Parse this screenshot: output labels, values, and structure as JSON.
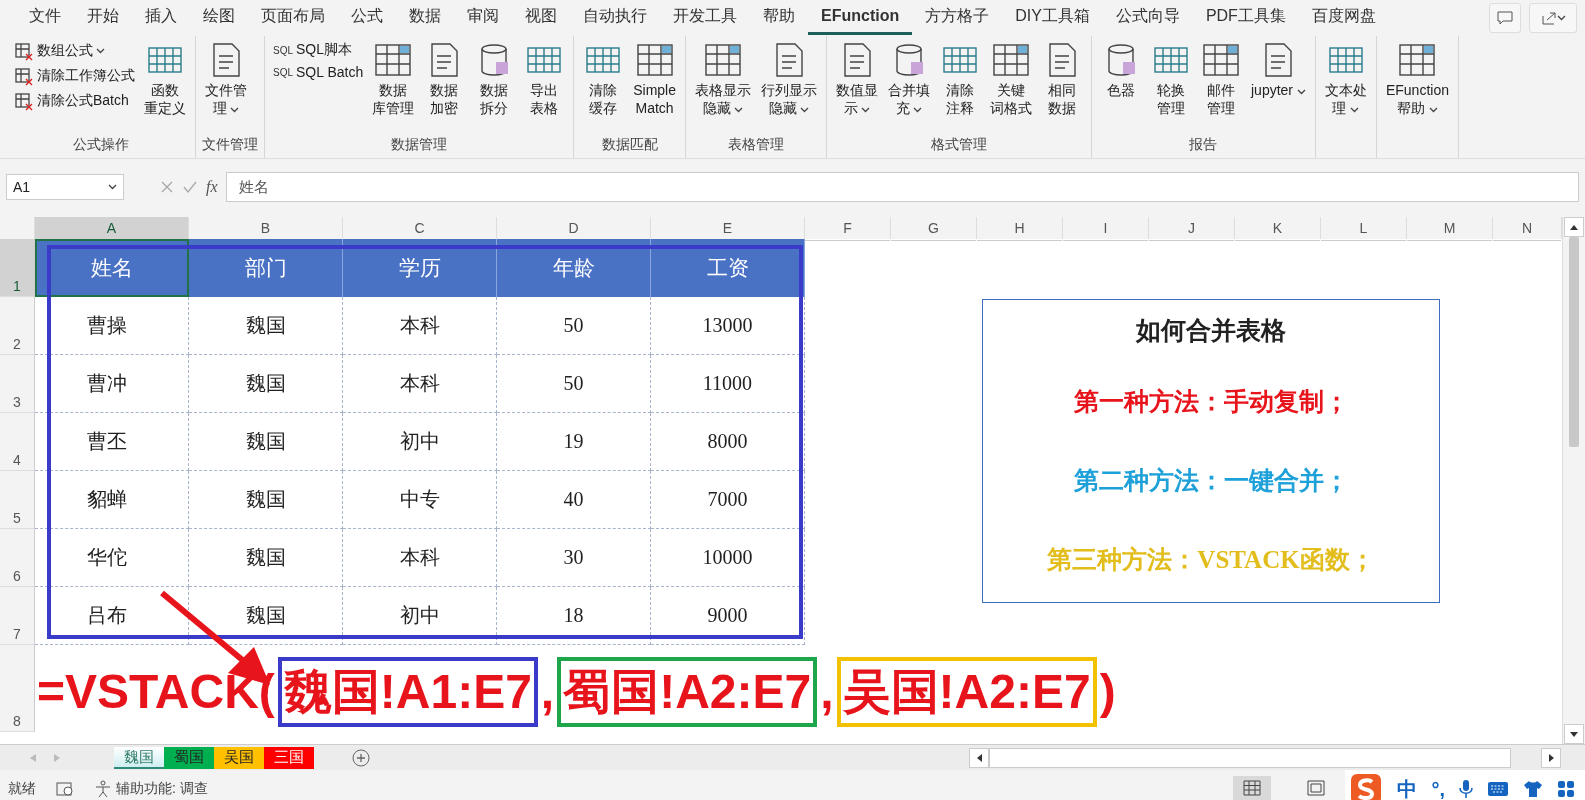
{
  "menu_tabs": [
    {
      "label": "文件",
      "selected": false
    },
    {
      "label": "开始",
      "selected": false
    },
    {
      "label": "插入",
      "selected": false
    },
    {
      "label": "绘图",
      "selected": false
    },
    {
      "label": "页面布局",
      "selected": false
    },
    {
      "label": "公式",
      "selected": false
    },
    {
      "label": "数据",
      "selected": false
    },
    {
      "label": "审阅",
      "selected": false
    },
    {
      "label": "视图",
      "selected": false
    },
    {
      "label": "自动执行",
      "selected": false
    },
    {
      "label": "开发工具",
      "selected": false
    },
    {
      "label": "帮助",
      "selected": false
    },
    {
      "label": "EFunction",
      "selected": true
    },
    {
      "label": "方方格子",
      "selected": false
    },
    {
      "label": "DIY工具箱",
      "selected": false
    },
    {
      "label": "公式向导",
      "selected": false
    },
    {
      "label": "PDF工具集",
      "selected": false
    },
    {
      "label": "百度网盘",
      "selected": false
    }
  ],
  "ribbon_groups": [
    {
      "label": "公式操作",
      "items": [
        {
          "kind": "small",
          "lines": [
            "数组公式"
          ],
          "dropdown": true
        },
        {
          "kind": "small",
          "lines": [
            "清除工作簿公式"
          ],
          "dropdown": false
        },
        {
          "kind": "small",
          "lines": [
            "清除公式Batch"
          ],
          "dropdown": false
        },
        {
          "kind": "large",
          "lines": [
            "函数",
            "重定义"
          ],
          "dropdown": false
        }
      ]
    },
    {
      "label": "文件管理",
      "items": [
        {
          "kind": "large",
          "lines": [
            "文件管",
            "理"
          ],
          "dropdown": true
        }
      ]
    },
    {
      "label": "数据管理",
      "items": [
        {
          "kind": "small",
          "prefix": "SQL",
          "lines": [
            "SQL脚本"
          ],
          "dropdown": false
        },
        {
          "kind": "small",
          "prefix": "SQL",
          "lines": [
            "SQL Batch"
          ],
          "dropdown": false
        },
        {
          "kind": "large",
          "lines": [
            "数据",
            "库管理"
          ],
          "dropdown": false
        },
        {
          "kind": "large",
          "lines": [
            "数据",
            "加密"
          ],
          "dropdown": false
        },
        {
          "kind": "large",
          "lines": [
            "数据",
            "拆分"
          ],
          "dropdown": false
        },
        {
          "kind": "large",
          "lines": [
            "导出",
            "表格"
          ],
          "dropdown": false
        }
      ]
    },
    {
      "label": "数据匹配",
      "items": [
        {
          "kind": "large",
          "lines": [
            "清除",
            "缓存"
          ],
          "dropdown": false
        },
        {
          "kind": "large",
          "lines": [
            "Simple",
            "Match"
          ],
          "dropdown": false
        }
      ]
    },
    {
      "label": "表格管理",
      "items": [
        {
          "kind": "large",
          "lines": [
            "表格显示",
            "隐藏"
          ],
          "dropdown": true
        },
        {
          "kind": "large",
          "lines": [
            "行列显示",
            "隐藏"
          ],
          "dropdown": true
        }
      ]
    },
    {
      "label": "格式管理",
      "items": [
        {
          "kind": "large",
          "lines": [
            "数值显",
            "示"
          ],
          "dropdown": true
        },
        {
          "kind": "large",
          "lines": [
            "合并填",
            "充"
          ],
          "dropdown": true
        },
        {
          "kind": "large",
          "lines": [
            "清除",
            "注释"
          ],
          "dropdown": false
        },
        {
          "kind": "large",
          "lines": [
            "关键",
            "词格式"
          ],
          "dropdown": false
        },
        {
          "kind": "large",
          "lines": [
            "相同",
            "数据"
          ],
          "dropdown": false
        }
      ]
    },
    {
      "label": "报告",
      "items": [
        {
          "kind": "large",
          "lines": [
            "色器"
          ],
          "dropdown": false
        },
        {
          "kind": "large",
          "lines": [
            "轮换",
            "管理"
          ],
          "dropdown": false
        },
        {
          "kind": "large",
          "lines": [
            "邮件",
            "管理"
          ],
          "dropdown": false
        },
        {
          "kind": "large",
          "lines": [
            "jupyter"
          ],
          "dropdown": true
        }
      ]
    },
    {
      "items": [
        {
          "kind": "large",
          "lines": [
            "文本处",
            "理"
          ],
          "dropdown": true
        }
      ]
    },
    {
      "items": [
        {
          "kind": "large",
          "lines": [
            "EFunction",
            "帮助"
          ],
          "dropdown": true
        }
      ]
    }
  ],
  "formula_bar": {
    "name_box": "A1",
    "fx": "fx",
    "value": "姓名"
  },
  "columns": [
    "A",
    "B",
    "C",
    "D",
    "E",
    "F",
    "G",
    "H",
    "I",
    "J",
    "K",
    "L",
    "M",
    "N"
  ],
  "rows": [
    "1",
    "2",
    "3",
    "4",
    "5",
    "6",
    "7",
    "8"
  ],
  "table": {
    "header": [
      "姓名",
      "部门",
      "学历",
      "年龄",
      "工资"
    ],
    "rows": [
      [
        "曹操",
        "魏国",
        "本科",
        "50",
        "13000"
      ],
      [
        "曹冲",
        "魏国",
        "本科",
        "50",
        "11000"
      ],
      [
        "曹丕",
        "魏国",
        "初中",
        "19",
        "8000"
      ],
      [
        "貂蝉",
        "魏国",
        "中专",
        "40",
        "7000"
      ],
      [
        "华佗",
        "魏国",
        "本科",
        "30",
        "10000"
      ],
      [
        "吕布",
        "魏国",
        "初中",
        "18",
        "9000"
      ]
    ]
  },
  "note_box": {
    "title": "如何合并表格",
    "lines": [
      {
        "text": "第一种方法：手动复制；",
        "color": "#e8141c"
      },
      {
        "text": "第二种方法：一键合并；",
        "color": "#1ea0d8"
      },
      {
        "text": "第三种方法：VSTACK函数；",
        "color": "#e2bd1c"
      }
    ]
  },
  "formula_overlay": [
    {
      "text": "=VSTACK("
    },
    {
      "text": "魏国!A1:E7",
      "color": "#3b3bc9"
    },
    {
      "text": ","
    },
    {
      "text": "蜀国!A2:E7",
      "color": "#1ea64a"
    },
    {
      "text": ","
    },
    {
      "text": "吴国!A2:E7",
      "color": "#f2c200"
    },
    {
      "text": ")"
    }
  ],
  "sheet_tabs": [
    {
      "label": "魏国",
      "selected": true,
      "color": "#2e8b7a"
    },
    {
      "label": "蜀国",
      "selected": false,
      "color": "#00b050"
    },
    {
      "label": "吴国",
      "selected": false,
      "color": "#ffc000"
    },
    {
      "label": "三国",
      "selected": false,
      "color": "#ff0000"
    }
  ],
  "status_bar": {
    "ready": "就绪",
    "accessibility": "辅助功能: 调查"
  },
  "ime_bar": [
    "中",
    "°,"
  ]
}
